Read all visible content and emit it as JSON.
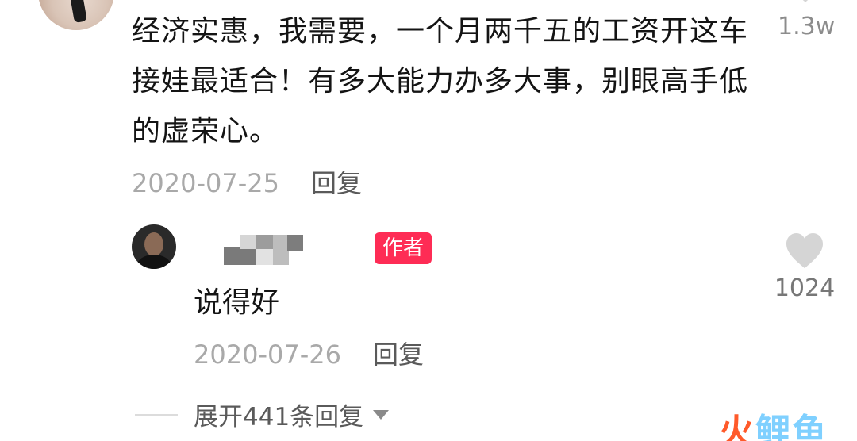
{
  "comment": {
    "text": "经济实惠，我需要，一个月两千五的工资开这车接娃最适合！有多大能力办多大事，别眼高手低的虚荣心。",
    "date": "2020-07-25",
    "reply_label": "回复",
    "like_count": "1.3w"
  },
  "reply": {
    "author_badge": "作者",
    "text": "说得好",
    "date": "2020-07-26",
    "reply_label": "回复",
    "like_count": "1024"
  },
  "expand": {
    "label": "展开441条回复"
  },
  "watermark": {
    "text_1": "火",
    "text_2": "鲤鱼"
  },
  "colors": {
    "author_badge": "#fe2c55",
    "heart": "#d5d5d5",
    "muted": "#a9a9a9"
  }
}
